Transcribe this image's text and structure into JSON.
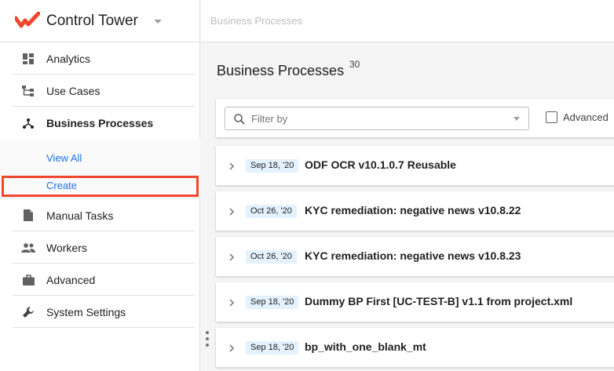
{
  "app": {
    "title": "Control Tower"
  },
  "sidebar": {
    "items": [
      {
        "label": "Analytics",
        "icon": "dashboard-icon"
      },
      {
        "label": "Use Cases",
        "icon": "hierarchy-icon"
      },
      {
        "label": "Business Processes",
        "icon": "process-icon",
        "active": true
      },
      {
        "label": "Manual Tasks",
        "icon": "document-icon"
      },
      {
        "label": "Workers",
        "icon": "people-icon"
      },
      {
        "label": "Advanced",
        "icon": "briefcase-icon"
      },
      {
        "label": "System Settings",
        "icon": "wrench-icon"
      }
    ],
    "sub_items": [
      {
        "label": "View All"
      },
      {
        "label": "Create"
      }
    ]
  },
  "header": {
    "breadcrumb": "Business Processes"
  },
  "main": {
    "title": "Business Processes",
    "count": "30",
    "filter": {
      "placeholder": "Filter by",
      "advanced_label": "Advanced"
    },
    "rows": [
      {
        "date": "Sep 18, '20",
        "name": "ODF OCR v10.1.0.7 Reusable"
      },
      {
        "date": "Oct 26, '20",
        "name": "KYC remediation: negative news v10.8.22"
      },
      {
        "date": "Oct 26, '20",
        "name": "KYC remediation: negative news v10.8.23"
      },
      {
        "date": "Sep 18, '20",
        "name": "Dummy BP First [UC-TEST-B] v1.1 from project.xml"
      },
      {
        "date": "Sep 18, '20",
        "name": "bp_with_one_blank_mt"
      }
    ]
  },
  "colors": {
    "brand": "#f0472c",
    "link": "#1a73e8",
    "highlight": "#f0472c"
  }
}
